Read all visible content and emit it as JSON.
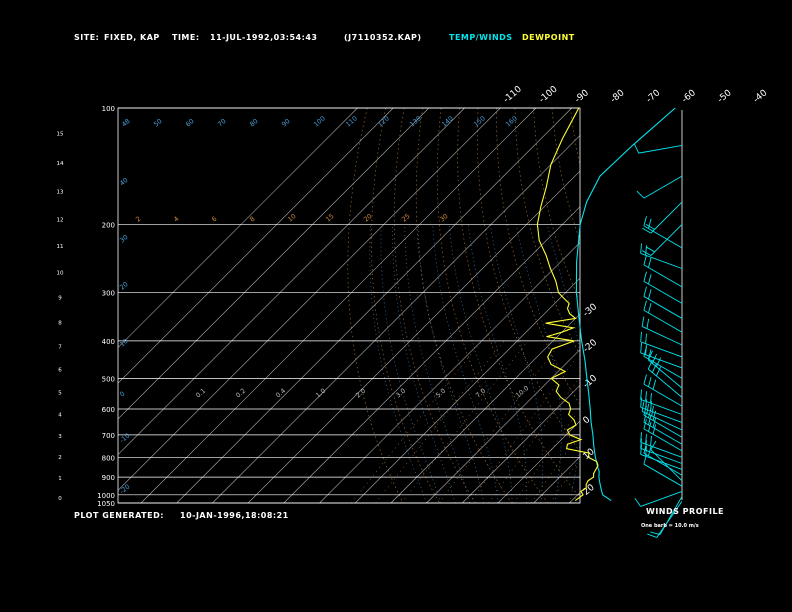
{
  "header": {
    "site_label": "SITE:",
    "site_value": "FIXED, KAP",
    "time_label": "TIME:",
    "time_value": "11-JUL-1992,03:54:43",
    "file": "(J7110352.KAP)",
    "temp_legend": "TEMP/WINDS",
    "dew_legend": "DEWPOINT"
  },
  "footer": {
    "generated_label": "PLOT GENERATED:",
    "generated_value": "10-JAN-1996,18:08:21"
  },
  "wind_panel": {
    "title": "WINDS PROFILE",
    "scale_note": "One barb = 10.0 m/s"
  },
  "colors": {
    "background": "#000000",
    "temperature": "#00e5ee",
    "dewpoint": "#ffff33",
    "isobar": "#ffffff",
    "isotherm": "#cfcfcf",
    "mixing_ratio": "#d08a3a",
    "dry_adiabat": "#d08a3a",
    "moist_adiabat": "#4a9fd8",
    "wind_barbs": "#00e5ee"
  },
  "chart_data": {
    "type": "skew-t log-p sounding",
    "pressure_ticks": [
      100,
      200,
      300,
      400,
      500,
      600,
      700,
      800,
      900,
      1000,
      1050
    ],
    "height_ticks_km": [
      0,
      1,
      2,
      3,
      4,
      5,
      6,
      7,
      8,
      9,
      10,
      11,
      12,
      13,
      14,
      15
    ],
    "temp_labels_top": [
      "-110",
      "-100",
      "-90",
      "-80",
      "-70",
      "-60",
      "-50",
      "-40"
    ],
    "temp_labels_right": [
      "-30",
      "-20",
      "-10",
      "0",
      "10",
      "20",
      "30"
    ],
    "moist_adiabat_labels": [
      "48",
      "50",
      "60",
      "70",
      "80",
      "90",
      "100",
      "110",
      "120",
      "130",
      "140",
      "150",
      "160"
    ],
    "dry_adiabat_left_labels": [
      "40",
      "30",
      "20",
      "10",
      "0",
      "-10",
      "-20",
      "-30"
    ],
    "mixing_ratio_upper_labels": [
      "2",
      "4",
      "6",
      "8",
      "10",
      "15",
      "20",
      "25",
      "30"
    ],
    "mixing_ratio_lower_labels": [
      "0.1",
      "0.2",
      "0.4",
      "1.0",
      "2.0",
      "3.0",
      "5.0",
      "7.0",
      "10.0"
    ],
    "temperature": {
      "name": "TEMP/WINDS",
      "p": [
        1035,
        1000,
        975,
        950,
        925,
        900,
        870,
        850,
        800,
        750,
        700,
        650,
        600,
        550,
        500,
        450,
        400,
        350,
        300,
        250,
        200,
        175,
        150,
        125,
        100
      ],
      "t": [
        31.0,
        27.0,
        25.5,
        24.0,
        22.5,
        21.0,
        19.5,
        18.0,
        14.5,
        11.0,
        7.5,
        3.5,
        -0.5,
        -5.0,
        -10.0,
        -15.5,
        -22.0,
        -29.0,
        -37.0,
        -45.5,
        -55.0,
        -59.5,
        -63.0,
        -62.5,
        -61.0
      ]
    },
    "dewpoint": {
      "name": "DEWPOINT",
      "p": [
        1035,
        1000,
        980,
        960,
        940,
        920,
        900,
        880,
        860,
        840,
        820,
        800,
        780,
        760,
        740,
        720,
        700,
        680,
        660,
        640,
        620,
        600,
        580,
        560,
        540,
        520,
        500,
        480,
        460,
        440,
        420,
        400,
        390,
        380,
        370,
        360,
        350,
        340,
        330,
        320,
        310,
        300,
        280,
        260,
        240,
        220,
        200,
        180,
        160,
        140,
        120,
        100
      ],
      "t": [
        21.0,
        21.5,
        20.0,
        20.5,
        19.5,
        19.0,
        19.5,
        18.5,
        18.0,
        17.5,
        16.0,
        12.5,
        11.5,
        4.0,
        3.0,
        5.5,
        1.0,
        -1.0,
        0.0,
        -2.0,
        -5.0,
        -6.0,
        -8.0,
        -12.0,
        -15.0,
        -16.0,
        -20.0,
        -18.0,
        -24.0,
        -27.0,
        -28.0,
        -24.0,
        -33.0,
        -30.0,
        -28.0,
        -37.0,
        -30.0,
        -33.0,
        -35.0,
        -36.0,
        -39.0,
        -42.0,
        -46.0,
        -51.0,
        -56.0,
        -62.0,
        -67.0,
        -71.0,
        -75.0,
        -80.0,
        -84.0,
        -88.0
      ]
    },
    "winds": [
      {
        "p": 1040,
        "dir": 215,
        "spd": 10
      },
      {
        "p": 1010,
        "dir": 210,
        "spd": 10
      },
      {
        "p": 980,
        "dir": 250,
        "spd": 10
      },
      {
        "p": 950,
        "dir": 300,
        "spd": 10
      },
      {
        "p": 920,
        "dir": 315,
        "spd": 10
      },
      {
        "p": 890,
        "dir": 300,
        "spd": 15
      },
      {
        "p": 860,
        "dir": 290,
        "spd": 20
      },
      {
        "p": 830,
        "dir": 290,
        "spd": 20
      },
      {
        "p": 800,
        "dir": 290,
        "spd": 25
      },
      {
        "p": 770,
        "dir": 300,
        "spd": 25
      },
      {
        "p": 740,
        "dir": 300,
        "spd": 25
      },
      {
        "p": 710,
        "dir": 300,
        "spd": 30
      },
      {
        "p": 680,
        "dir": 295,
        "spd": 30
      },
      {
        "p": 650,
        "dir": 290,
        "spd": 30
      },
      {
        "p": 620,
        "dir": 290,
        "spd": 25
      },
      {
        "p": 590,
        "dir": 300,
        "spd": 25
      },
      {
        "p": 560,
        "dir": 310,
        "spd": 25
      },
      {
        "p": 530,
        "dir": 310,
        "spd": 25
      },
      {
        "p": 500,
        "dir": 300,
        "spd": 20
      },
      {
        "p": 470,
        "dir": 290,
        "spd": 20
      },
      {
        "p": 440,
        "dir": 290,
        "spd": 20
      },
      {
        "p": 410,
        "dir": 295,
        "spd": 20
      },
      {
        "p": 380,
        "dir": 300,
        "spd": 15
      },
      {
        "p": 350,
        "dir": 300,
        "spd": 15
      },
      {
        "p": 320,
        "dir": 300,
        "spd": 15
      },
      {
        "p": 290,
        "dir": 300,
        "spd": 15
      },
      {
        "p": 260,
        "dir": 290,
        "spd": 15
      },
      {
        "p": 230,
        "dir": 300,
        "spd": 20
      },
      {
        "p": 200,
        "dir": 225,
        "spd": 15
      },
      {
        "p": 175,
        "dir": 225,
        "spd": 15
      },
      {
        "p": 150,
        "dir": 240,
        "spd": 10
      },
      {
        "p": 125,
        "dir": 260,
        "spd": 10
      }
    ]
  }
}
